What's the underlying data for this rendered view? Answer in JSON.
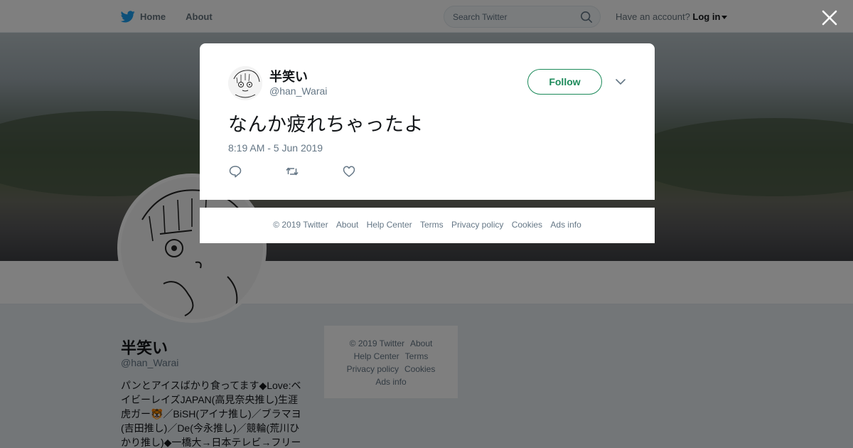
{
  "nav": {
    "home_label": "Home",
    "about_label": "About",
    "search_placeholder": "Search Twitter",
    "account_prompt": "Have an account?",
    "login_label": "Log in"
  },
  "profile": {
    "name": "半笑い",
    "handle": "@han_Warai",
    "bio": "パンとアイスばかり食ってます◆Love:ベイビーレイズJAPAN(高見奈央推し)生涯虎ガー🐯／BiSH(アイナ推し)／ブラマヨ(吉田推し)／De(今永推し)／競輪(荒川ひかり推し)◆一橋大→日本テレビ→フリー"
  },
  "side_footer": {
    "copyright": "© 2019 Twitter",
    "about": "About",
    "help": "Help Center",
    "terms": "Terms",
    "privacy": "Privacy policy",
    "cookies": "Cookies",
    "ads": "Ads info"
  },
  "tweet": {
    "author_name": "半笑い",
    "author_handle": "@han_Warai",
    "follow_label": "Follow",
    "text": "なんか疲れちゃったよ",
    "timestamp": "8:19 AM - 5 Jun 2019"
  },
  "modal_footer": {
    "copyright": "© 2019 Twitter",
    "about": "About",
    "help": "Help Center",
    "terms": "Terms",
    "privacy": "Privacy policy",
    "cookies": "Cookies",
    "ads": "Ads info"
  },
  "colors": {
    "twitter_blue": "#1da1f2",
    "follow_green": "#1c8a5a",
    "text_gray": "#657786"
  },
  "icons": [
    "twitter-bird-icon",
    "search-icon",
    "close-icon",
    "chevron-down-icon",
    "reply-icon",
    "retweet-icon",
    "like-icon"
  ]
}
